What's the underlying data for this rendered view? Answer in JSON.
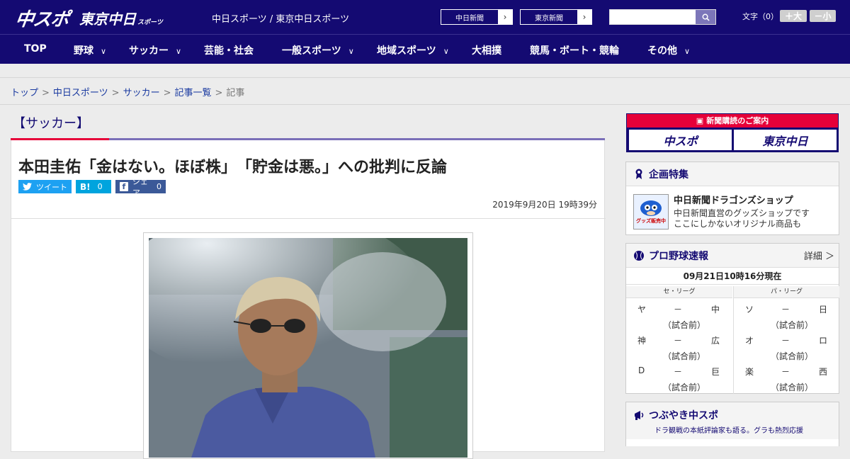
{
  "header": {
    "logo_main": "中スポ",
    "logo_tokyo": "東京中日",
    "logo_tokyo_small": "スポーツ",
    "site_title": "中日スポーツ / 東京中日スポーツ",
    "paper_links": [
      "中日新聞",
      "東京新聞"
    ],
    "search_placeholder": "",
    "font_label": "文字（0）",
    "font_larger": "＋大",
    "font_smaller": "－小"
  },
  "nav": {
    "items": [
      {
        "label": "TOP",
        "dropdown": false
      },
      {
        "label": "野球",
        "dropdown": true
      },
      {
        "label": "サッカー",
        "dropdown": true
      },
      {
        "label": "芸能・社会",
        "dropdown": false
      },
      {
        "label": "一般スポーツ",
        "dropdown": true
      },
      {
        "label": "地域スポーツ",
        "dropdown": true
      },
      {
        "label": "大相撲",
        "dropdown": false
      },
      {
        "label": "競馬・ボート・競輪",
        "dropdown": false
      },
      {
        "label": "その他",
        "dropdown": true
      }
    ]
  },
  "breadcrumb": [
    "トップ",
    "中日スポーツ",
    "サッカー",
    "記事一覧",
    "記事"
  ],
  "section": "【サッカー】",
  "article": {
    "headline": "本田圭佑「金はない。ほぼ株」　「貯金は悪。」への批判に反論",
    "share": {
      "tweet": "ツイート",
      "hatena_count": "0",
      "facebook": "シェア",
      "facebook_count": "0"
    },
    "date": "2019年9月20日 19時39分"
  },
  "ad": {
    "title": "新聞購読のご案内",
    "buttons": [
      "中スポ",
      "東京中日"
    ]
  },
  "special": {
    "title": "企画特集",
    "thumb_text": "グッズ販売中",
    "item_title": "中日新聞ドラゴンズショップ",
    "item_desc": [
      "中日新聞直営のグッズショップです",
      "ここにしかないオリジナル商品も"
    ]
  },
  "baseball": {
    "title": "プロ野球速報",
    "detail": "詳細 ＞",
    "time": "09月21日10時16分現在",
    "leagues": [
      "セ・リーグ",
      "パ・リーグ"
    ],
    "central": [
      {
        "home": "ヤ",
        "dash": "－",
        "away": "中",
        "status": "（試合前）"
      },
      {
        "home": "神",
        "dash": "－",
        "away": "広",
        "status": "（試合前）"
      },
      {
        "home": "D",
        "dash": "－",
        "away": "巨",
        "status": "（試合前）"
      }
    ],
    "pacific": [
      {
        "home": "ソ",
        "dash": "－",
        "away": "日",
        "status": "（試合前）"
      },
      {
        "home": "オ",
        "dash": "－",
        "away": "ロ",
        "status": "（試合前）"
      },
      {
        "home": "楽",
        "dash": "－",
        "away": "西",
        "status": "（試合前）"
      }
    ]
  },
  "tsubuyaki": {
    "title": "つぶやき中スポ",
    "subtitle": "ドラ観戦の本紙評論家も語る。グラも熱烈応援"
  },
  "colors": {
    "brand": "#140a72",
    "accent": "#e60039",
    "twitter": "#1da1f2",
    "hatena": "#00a4de",
    "facebook": "#3b5998"
  }
}
